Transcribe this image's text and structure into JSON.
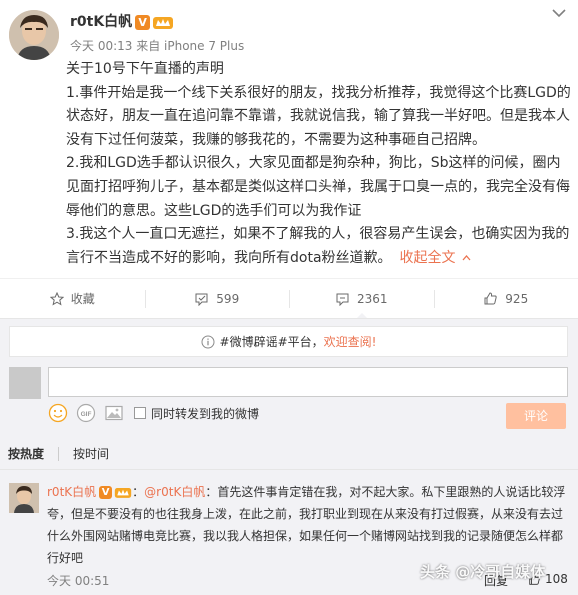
{
  "post": {
    "author": "r0tK白帆",
    "verified_badge": "V",
    "meta": "今天 00:13 来自 iPhone 7 Plus",
    "paragraphs": [
      "关于10号下午直播的声明",
      "1.事件开始是我一个线下关系很好的朋友，找我分析推荐，我觉得这个比赛LGD的状态好，朋友一直在追问靠不靠谱，我就说信我，输了算我一半好吧。但是我本人没有下过任何菠菜，我赚的够我花的，不需要为这种事砸自己招牌。",
      "2.我和LGD选手都认识很久，大家见面都是狗杂种，狗比，Sb这样的问候，圈内见面打招呼狗儿子，基本都是类似这样口头禅，我属于口臭一点的，我完全没有侮辱他们的意思。这些LGD的选手们可以为我作证",
      "3.我这个人一直口无遮拦，如果不了解我的人，很容易产生误会，也确实因为我的言行不当造成不好的影响，我向所有dota粉丝道歉。"
    ],
    "collapse_label": "收起全文"
  },
  "actions": {
    "favorite": "收藏",
    "repost_count": "599",
    "comment_count": "2361",
    "like_count": "925"
  },
  "comment_area": {
    "notice_prefix": "#微博辟谣#平台，",
    "notice_link": "欢迎查阅!",
    "input_value": "",
    "repost_checkbox_label": "同时转发到我的微博",
    "submit_label": "评论",
    "sort_hot": "按热度",
    "sort_time": "按时间"
  },
  "comments": [
    {
      "author": "r0tK白帆",
      "mention": "@r0tK白帆",
      "text": "：首先这件事肯定错在我，对不起大家。私下里跟熟的人说话比较浮夸，但是不要没有的也往我身上泼，在此之前，我打职业到现在从来没有打过假赛，从来没有去过什么外围网站赌博电竞比赛，我以我人格担保，如果任何一个赌博网站找到我的记录随便怎么样都行好吧",
      "time": "今天 00:51",
      "reply": "回复",
      "likes": "108"
    }
  ],
  "watermark": "头条 @冷哥自媒体",
  "colors": {
    "accent": "#eb7350",
    "badge_orange": "#f08a24",
    "panel_bg": "#f2f2f5",
    "submit_disabled": "#ffc09f"
  }
}
